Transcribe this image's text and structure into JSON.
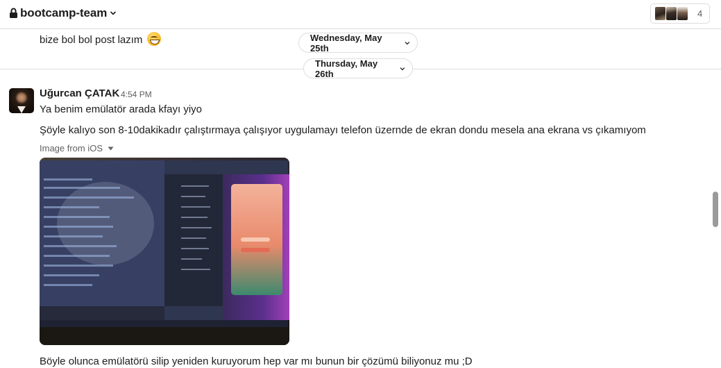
{
  "header": {
    "channel_name": "bootcamp-team",
    "member_count": "4"
  },
  "messages": {
    "previous_message": "bize bol bol post lazım",
    "date_dividers": [
      "Wednesday, May 25th",
      "Thursday, May 26th"
    ],
    "sender": "Uğurcan ÇATAK",
    "time": "4:54 PM",
    "line1": "Ya benim emülatör arada kfayı yiyo",
    "line2": "Şöyle kalıyo son 8-10dakikadır çalıştırmaya çalışıyor uygulamayı telefon üzernde de ekran dondu mesela ana ekrana vs çıkamıyom",
    "image_label": "Image from iOS",
    "line3": "Böyle olunca emülatörü silip yeniden kuruyorum hep var mı bunun bir çözümü biliyonuz mu ;D"
  },
  "icons": {
    "lock": "lock-icon",
    "channel_chevron": "chevron-down-icon",
    "emoji": "grinning-face-icon",
    "date_chevron": "chevron-down-icon",
    "image_caret": "caret-down-icon"
  },
  "colors": {
    "text": "#1d1c1d",
    "muted": "#616061",
    "border": "#dddddd"
  }
}
